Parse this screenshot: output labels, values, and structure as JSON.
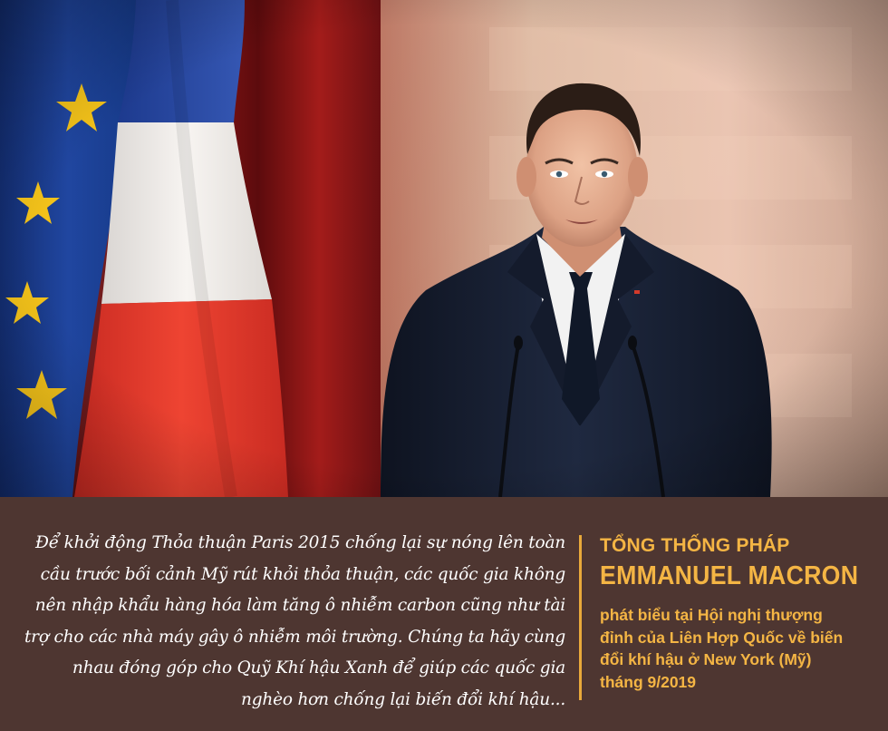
{
  "caption": {
    "quote": "Để khởi động Thỏa thuận Paris 2015 chống lại sự nóng lên toàn cầu trước bối cảnh Mỹ rút khỏi thỏa thuận, các quốc gia không nên nhập khẩu hàng hóa làm tăng ô nhiễm carbon cũng như tài trợ cho các nhà máy gây ô nhiễm môi trường. Chúng ta hãy cùng nhau đóng góp cho Quỹ Khí hậu Xanh để giúp các quốc gia nghèo hơn chống lại biến đổi khí hậu...",
    "speaker_role": "TỔNG THỐNG PHÁP",
    "speaker_name": "EMMANUEL MACRON",
    "context": "phát biểu tại Hội nghị thượng đỉnh của Liên Hợp Quốc về biến đổi khí hậu ở New York (Mỹ) tháng 9/2019"
  },
  "colors": {
    "panel_background": "#4e3631",
    "accent": "#f4b544",
    "quote_text": "#ffffff",
    "eu_flag_blue": "#1f3f8f",
    "eu_star_yellow": "#f3c21a",
    "french_blue": "#2c4ea8",
    "french_white": "#f4f1ee",
    "french_red": "#e23a2c",
    "suit": "#1a2235",
    "curtain_red": "#7a1414"
  },
  "icons": [
    "eu-flag",
    "french-flag",
    "microphone"
  ]
}
